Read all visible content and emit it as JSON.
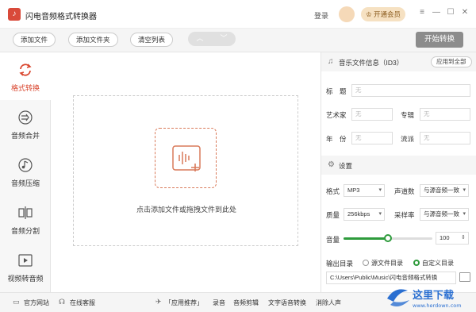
{
  "app": {
    "title": "闪电音频格式转换器",
    "login": "登录",
    "vip": "开通会员",
    "window_controls": [
      "menu-icon",
      "minimize-icon",
      "maximize-icon",
      "close-icon"
    ]
  },
  "toolbar": {
    "add_file": "添加文件",
    "add_folder": "添加文件夹",
    "clear_list": "清空列表",
    "start": "开始转换"
  },
  "sidebar": {
    "items": [
      {
        "label": "格式转换",
        "icon": "convert-icon",
        "active": true
      },
      {
        "label": "音频合并",
        "icon": "merge-icon",
        "active": false
      },
      {
        "label": "音频压缩",
        "icon": "compress-icon",
        "active": false
      },
      {
        "label": "音频分割",
        "icon": "split-icon",
        "active": false
      },
      {
        "label": "视频转音频",
        "icon": "video-to-audio-icon",
        "active": false
      }
    ]
  },
  "dropzone": {
    "hint": "点击添加文件或拖拽文件到此处"
  },
  "id3": {
    "title": "音乐文件信息（ID3）",
    "apply_all": "应用到全部",
    "fields": {
      "title_label": "标　题",
      "artist_label": "艺术家",
      "album_label": "专辑",
      "year_label": "年　份",
      "genre_label": "流派",
      "placeholder": "无"
    }
  },
  "settings": {
    "title": "设置",
    "format_label": "格式",
    "format_value": "MP3",
    "channels_label": "声道数",
    "channels_value": "与源音频一致",
    "quality_label": "质量",
    "quality_value": "256kbps",
    "samplerate_label": "采样率",
    "samplerate_value": "与源音频一致",
    "volume_label": "音量",
    "volume_value": "100",
    "volume_fraction": 0.5,
    "output_label": "输出目录",
    "output_source": "源文件目录",
    "output_custom": "自定义目录",
    "output_selected": "custom",
    "output_path": "C:\\Users\\Public\\Music\\闪电音频格式转换"
  },
  "footer": {
    "website": "官方网站",
    "service": "在线客服",
    "recommend": "「应用推荐」",
    "links": [
      "录音",
      "音频剪辑",
      "文字语音转换",
      "消除人声"
    ]
  },
  "watermark": {
    "text": "这里下载",
    "url": "www.herdown.com"
  },
  "colors": {
    "accent": "#d9462e",
    "green": "#2e9b3c",
    "start_button": "#8c8c8c"
  }
}
